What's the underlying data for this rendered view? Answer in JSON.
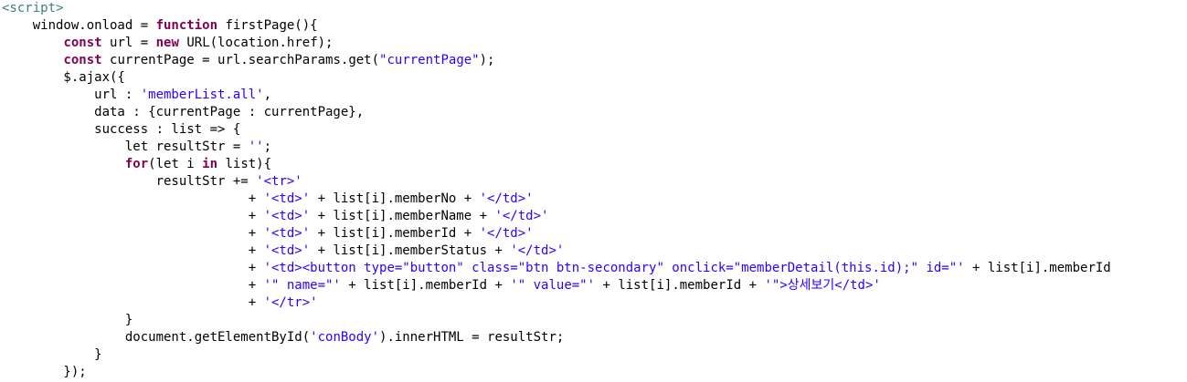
{
  "editor": {
    "colors": {
      "background": "#ffffff",
      "tag": "#3f7f7f",
      "keyword": "#7f0055",
      "string": "#2a00ff",
      "plain": "#000000"
    },
    "lines": [
      [
        {
          "t": "tag",
          "v": "<script>"
        }
      ],
      [
        {
          "t": "plain",
          "v": "    window.onload = "
        },
        {
          "t": "kw",
          "v": "function"
        },
        {
          "t": "plain",
          "v": " firstPage(){"
        }
      ],
      [
        {
          "t": "plain",
          "v": "        "
        },
        {
          "t": "kw",
          "v": "const"
        },
        {
          "t": "plain",
          "v": " url = "
        },
        {
          "t": "kw",
          "v": "new"
        },
        {
          "t": "plain",
          "v": " URL(location.href);"
        }
      ],
      [
        {
          "t": "plain",
          "v": "        "
        },
        {
          "t": "kw",
          "v": "const"
        },
        {
          "t": "plain",
          "v": " currentPage = url.searchParams.get("
        },
        {
          "t": "str",
          "v": "\"currentPage\""
        },
        {
          "t": "plain",
          "v": ");"
        }
      ],
      [
        {
          "t": "plain",
          "v": "        $.ajax({"
        }
      ],
      [
        {
          "t": "plain",
          "v": "            url : "
        },
        {
          "t": "str",
          "v": "'memberList.all'"
        },
        {
          "t": "plain",
          "v": ","
        }
      ],
      [
        {
          "t": "plain",
          "v": "            data : {currentPage : currentPage},"
        }
      ],
      [
        {
          "t": "plain",
          "v": "            success : list => {"
        }
      ],
      [
        {
          "t": "plain",
          "v": "                let resultStr = "
        },
        {
          "t": "str",
          "v": "''"
        },
        {
          "t": "plain",
          "v": ";"
        }
      ],
      [
        {
          "t": "plain",
          "v": "                "
        },
        {
          "t": "kw",
          "v": "for"
        },
        {
          "t": "plain",
          "v": "(let i "
        },
        {
          "t": "kw",
          "v": "in"
        },
        {
          "t": "plain",
          "v": " list){"
        }
      ],
      [
        {
          "t": "plain",
          "v": "                    resultStr += "
        },
        {
          "t": "str",
          "v": "'<tr>'"
        }
      ],
      [
        {
          "t": "plain",
          "v": "                                + "
        },
        {
          "t": "str",
          "v": "'<td>'"
        },
        {
          "t": "plain",
          "v": " + list[i].memberNo + "
        },
        {
          "t": "str",
          "v": "'</td>'"
        }
      ],
      [
        {
          "t": "plain",
          "v": "                                + "
        },
        {
          "t": "str",
          "v": "'<td>'"
        },
        {
          "t": "plain",
          "v": " + list[i].memberName + "
        },
        {
          "t": "str",
          "v": "'</td>'"
        }
      ],
      [
        {
          "t": "plain",
          "v": "                                + "
        },
        {
          "t": "str",
          "v": "'<td>'"
        },
        {
          "t": "plain",
          "v": " + list[i].memberId + "
        },
        {
          "t": "str",
          "v": "'</td>'"
        }
      ],
      [
        {
          "t": "plain",
          "v": "                                + "
        },
        {
          "t": "str",
          "v": "'<td>'"
        },
        {
          "t": "plain",
          "v": " + list[i].memberStatus + "
        },
        {
          "t": "str",
          "v": "'</td>'"
        }
      ],
      [
        {
          "t": "plain",
          "v": "                                + "
        },
        {
          "t": "str",
          "v": "'<td><button type=\"button\" class=\"btn btn-secondary\" onclick=\"memberDetail(this.id);\" id=\"'"
        },
        {
          "t": "plain",
          "v": " + list[i].memberId"
        }
      ],
      [
        {
          "t": "plain",
          "v": "                                + "
        },
        {
          "t": "str",
          "v": "'\" name=\"'"
        },
        {
          "t": "plain",
          "v": " + list[i].memberId + "
        },
        {
          "t": "str",
          "v": "'\" value=\"'"
        },
        {
          "t": "plain",
          "v": " + list[i].memberId + "
        },
        {
          "t": "str",
          "v": "'\">상세보기</td>'"
        }
      ],
      [
        {
          "t": "plain",
          "v": "                                + "
        },
        {
          "t": "str",
          "v": "'</tr>'"
        }
      ],
      [
        {
          "t": "plain",
          "v": "                }"
        }
      ],
      [
        {
          "t": "plain",
          "v": "                document.getElementById("
        },
        {
          "t": "str",
          "v": "'conBody'"
        },
        {
          "t": "plain",
          "v": ").innerHTML = resultStr;"
        }
      ],
      [
        {
          "t": "plain",
          "v": "            }"
        }
      ],
      [
        {
          "t": "plain",
          "v": "        });"
        }
      ]
    ]
  }
}
